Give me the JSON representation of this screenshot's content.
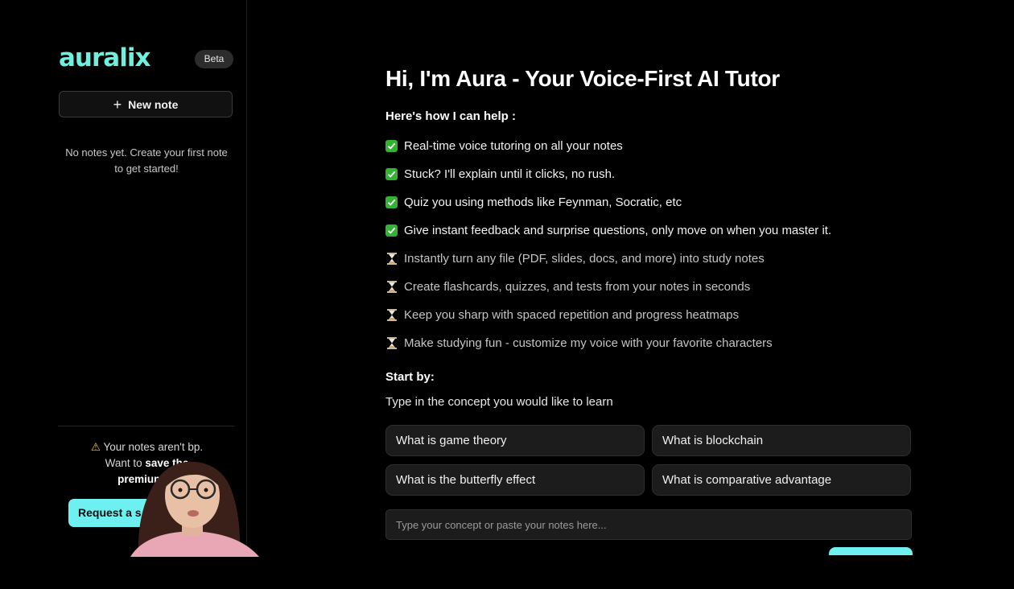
{
  "sidebar": {
    "logo": "auralix",
    "beta_badge": "Beta",
    "new_note_label": "New note",
    "empty_message": "No notes yet. Create your first note to get started!",
    "warning": {
      "line1": "Your notes aren't b",
      "line1_tail": "p.",
      "line2_prefix": "Want to ",
      "line2_bold": "save the",
      "line3_bold": "premium fe"
    },
    "request_button_label": "Request a s"
  },
  "main": {
    "title": "Hi, I'm Aura - Your Voice-First AI Tutor",
    "help_heading": "Here's how I can help :",
    "features": [
      {
        "text": "Real-time voice tutoring on all your notes",
        "status": "done"
      },
      {
        "text": "Stuck? I'll explain until it clicks, no rush.",
        "status": "done"
      },
      {
        "text": "Quiz you using methods like Feynman, Socratic, etc",
        "status": "done"
      },
      {
        "text": "Give instant feedback and surprise questions, only move on when you master it.",
        "status": "done"
      },
      {
        "text": "Instantly turn any file (PDF, slides, docs, and more) into study notes",
        "status": "pending"
      },
      {
        "text": "Create flashcards, quizzes, and tests from your notes in seconds",
        "status": "pending"
      },
      {
        "text": "Keep you sharp with spaced repetition and progress heatmaps",
        "status": "pending"
      },
      {
        "text": "Make studying fun - customize my voice with your favorite characters",
        "status": "pending"
      }
    ],
    "start_heading": "Start by:",
    "start_sub": "Type in the concept you would like to learn",
    "suggestions": [
      "What is game theory",
      "What is blockchain",
      "What is the butterfly effect",
      "What is comparative advantage"
    ],
    "input_placeholder": "Type your concept or paste your notes here..."
  },
  "colors": {
    "accent": "#6ff0df",
    "button_accent": "#6ff0f0",
    "check_green": "#34b233",
    "background": "#000000"
  },
  "icons": {
    "done": "check-icon",
    "pending": "hourglass-icon",
    "new_note": "plus-icon",
    "warning": "warning-icon"
  }
}
